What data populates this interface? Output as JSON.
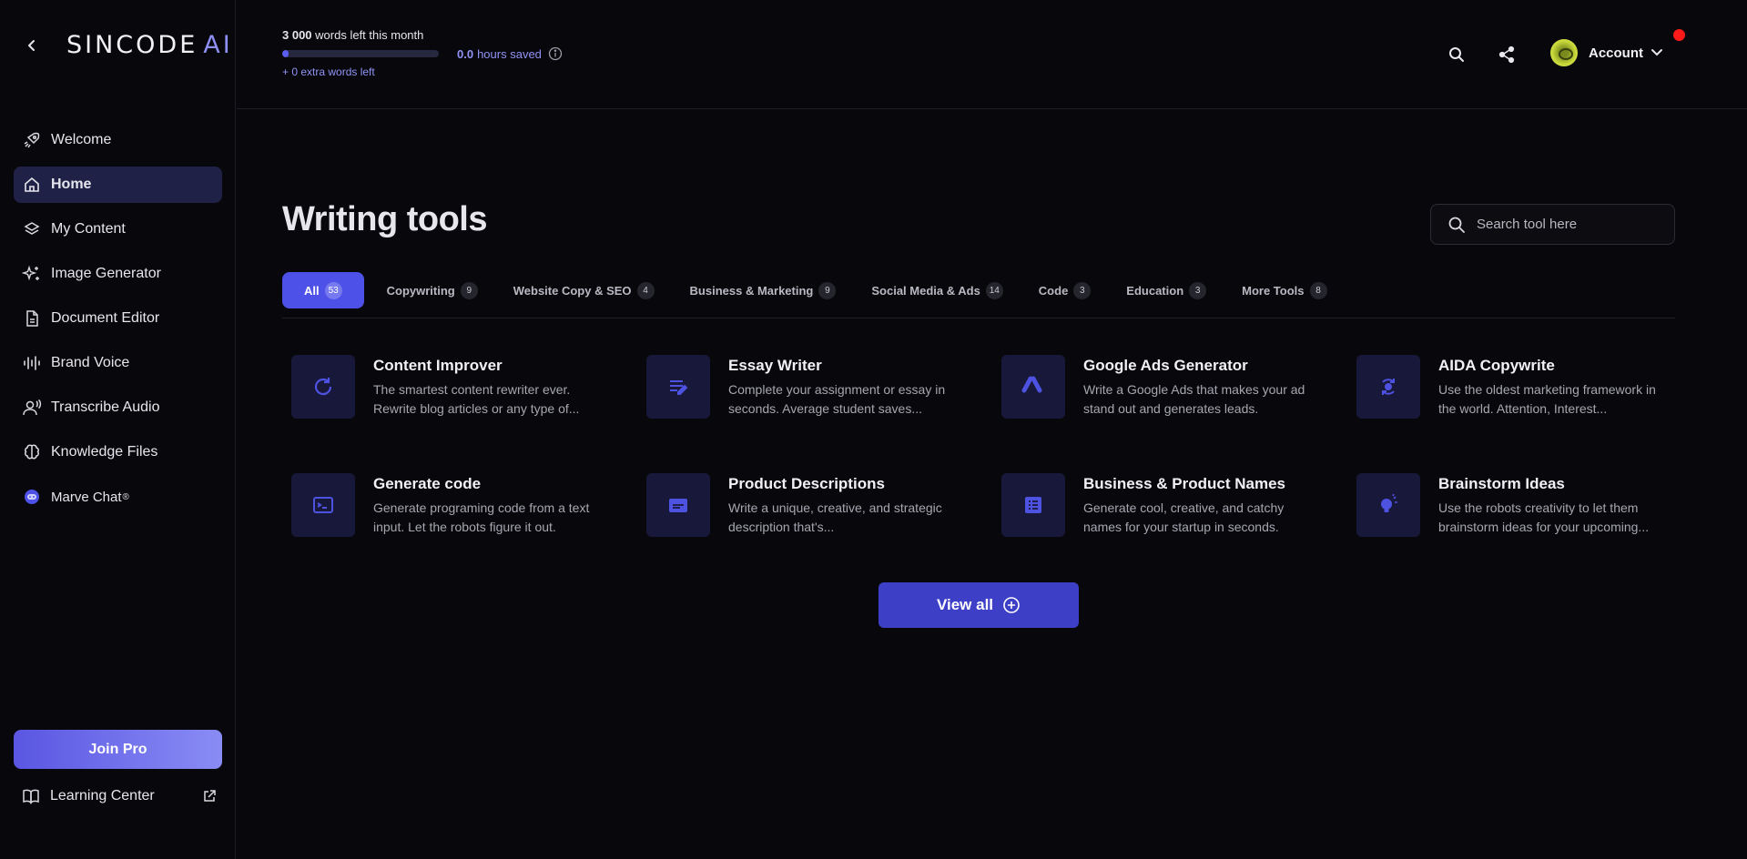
{
  "brand": {
    "name": "SINCODE",
    "ai": "AI"
  },
  "sidebar": {
    "items": [
      {
        "label": "Welcome",
        "icon": "rocket-icon",
        "active": false
      },
      {
        "label": "Home",
        "icon": "home-icon",
        "active": true
      },
      {
        "label": "My Content",
        "icon": "layers-icon",
        "active": false
      },
      {
        "label": "Image Generator",
        "icon": "sparkles-icon",
        "active": false
      },
      {
        "label": "Document Editor",
        "icon": "document-icon",
        "active": false
      },
      {
        "label": "Brand Voice",
        "icon": "soundwave-icon",
        "active": false
      },
      {
        "label": "Transcribe Audio",
        "icon": "voice-user-icon",
        "active": false
      },
      {
        "label": "Knowledge Files",
        "icon": "brain-icon",
        "active": false
      },
      {
        "label": "Marve Chat",
        "icon": "chat-bot-icon",
        "active": false,
        "sup": "®"
      }
    ],
    "join_pro": "Join Pro",
    "learning_center": "Learning Center"
  },
  "header": {
    "words_count": "3 000",
    "words_text": " words left this month",
    "progress_fraction": 0.04,
    "extra_words": "+ 0 extra words left",
    "hours_value": "0.0",
    "hours_text": "hours saved",
    "account_label": "Account"
  },
  "main": {
    "title": "Writing tools",
    "search_placeholder": "Search tool here",
    "tabs": [
      {
        "label": "All",
        "count": "53",
        "active": true
      },
      {
        "label": "Copywriting",
        "count": "9"
      },
      {
        "label": "Website Copy & SEO",
        "count": "4"
      },
      {
        "label": "Business & Marketing",
        "count": "9"
      },
      {
        "label": "Social Media & Ads",
        "count": "14"
      },
      {
        "label": "Code",
        "count": "3"
      },
      {
        "label": "Education",
        "count": "3"
      },
      {
        "label": "More Tools",
        "count": "8"
      }
    ],
    "tools": [
      {
        "name": "Content Improver",
        "desc": "The smartest content rewriter ever. Rewrite blog articles or any type of...",
        "icon": "refresh-icon"
      },
      {
        "name": "Essay Writer",
        "desc": "Complete your assignment or essay in seconds. Average student saves...",
        "icon": "edit-lines-icon"
      },
      {
        "name": "Google Ads Generator",
        "desc": "Write a Google Ads that makes your ad stand out and generates leads.",
        "icon": "google-ads-icon"
      },
      {
        "name": "AIDA Copywrite",
        "desc": "Use the oldest marketing framework in the world. Attention, Interest...",
        "icon": "cycle-icon"
      },
      {
        "name": "Generate code",
        "desc": "Generate programing code from a text input. Let the robots figure it out.",
        "icon": "terminal-icon"
      },
      {
        "name": "Product Descriptions",
        "desc": "Write a unique, creative, and strategic description that's...",
        "icon": "subtitles-icon"
      },
      {
        "name": "Business & Product Names",
        "desc": "Generate cool, creative, and catchy names for your startup in seconds.",
        "icon": "list-alt-icon"
      },
      {
        "name": "Brainstorm Ideas",
        "desc": "Use the robots creativity to let them brainstorm ideas for your upcoming...",
        "icon": "lightbulb-icon"
      }
    ],
    "view_all": "View all"
  },
  "colors": {
    "accent": "#4d51e8",
    "tile": "#17183a",
    "background": "#08080c"
  }
}
